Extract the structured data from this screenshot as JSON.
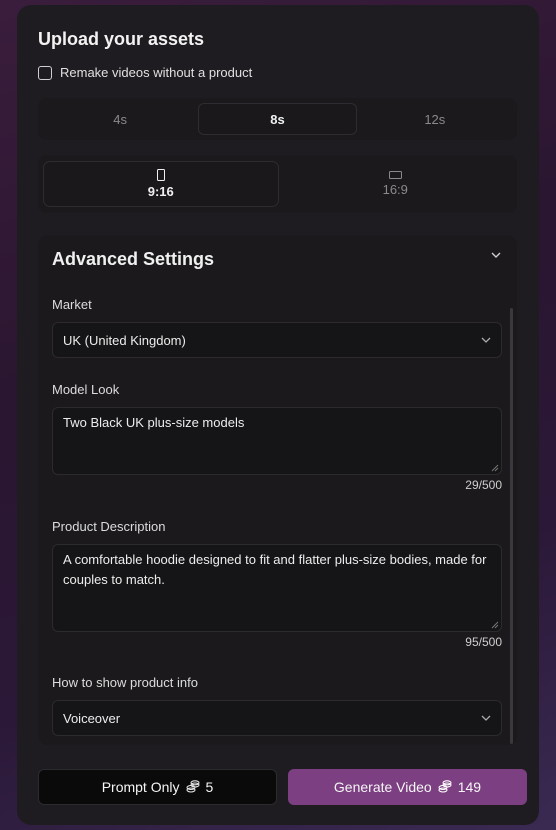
{
  "header": {
    "title": "Upload your assets"
  },
  "remake": {
    "label": "Remake videos without a product",
    "checked": false
  },
  "duration": {
    "options": [
      "4s",
      "8s",
      "12s"
    ],
    "selected": "8s"
  },
  "aspect": {
    "options": [
      "9:16",
      "16:9"
    ],
    "selected": "9:16"
  },
  "advanced": {
    "title": "Advanced Settings",
    "market": {
      "label": "Market",
      "value": "UK (United Kingdom)"
    },
    "model_look": {
      "label": "Model Look",
      "value": "Two Black UK plus-size models",
      "counter": "29/500"
    },
    "product_description": {
      "label": "Product Description",
      "value": "A comfortable hoodie designed to fit and flatter plus-size bodies, made for couples to match.",
      "counter": "95/500"
    },
    "product_info": {
      "label": "How to show product info",
      "value": "Voiceover"
    }
  },
  "actions": {
    "prompt_only": {
      "label": "Prompt Only",
      "cost": "5"
    },
    "generate": {
      "label": "Generate Video",
      "cost": "149"
    }
  },
  "colors": {
    "accent": "#7c3f82",
    "panel": "#1f1c21"
  },
  "icons": [
    "chevron-down-icon",
    "portrait-icon",
    "landscape-icon",
    "coins-icon",
    "checkbox-icon",
    "resize-handle-icon"
  ]
}
